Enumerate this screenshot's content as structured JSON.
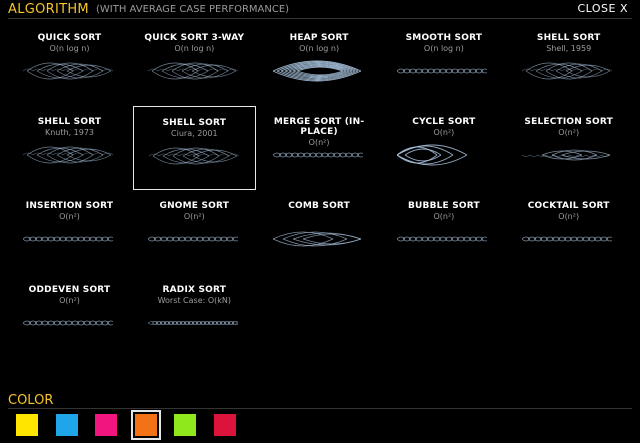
{
  "header": {
    "title": "ALGORITHM",
    "subtitle": "(WITH AVERAGE CASE PERFORMANCE)",
    "close_label": "CLOSE X"
  },
  "algorithms": [
    {
      "name": "QUICK SORT",
      "perf": "O(n log n)",
      "icon": "spread-arcs-icon"
    },
    {
      "name": "QUICK SORT 3-WAY",
      "perf": "O(n log n)",
      "icon": "spread-arcs-icon"
    },
    {
      "name": "HEAP SORT",
      "perf": "O(n log n)",
      "icon": "heap-arcs-icon"
    },
    {
      "name": "SMOOTH SORT",
      "perf": "O(n log n)",
      "icon": "chain-arcs-icon"
    },
    {
      "name": "SHELL SORT",
      "perf": "Shell, 1959",
      "icon": "spread-arcs-icon"
    },
    {
      "name": "SHELL SORT",
      "perf": "Knuth, 1973",
      "icon": "spread-arcs-icon"
    },
    {
      "name": "SHELL SORT",
      "perf": "Ciura, 2001",
      "icon": "spread-arcs-icon"
    },
    {
      "name": "MERGE SORT (IN-PLACE)",
      "perf": "O(n²)",
      "icon": "chain-arcs-icon"
    },
    {
      "name": "CYCLE SORT",
      "perf": "O(n²)",
      "icon": "cycle-arcs-icon"
    },
    {
      "name": "SELECTION SORT",
      "perf": "O(n²)",
      "icon": "selection-arcs-icon"
    },
    {
      "name": "INSERTION SORT",
      "perf": "O(n²)",
      "icon": "chain-arcs-icon"
    },
    {
      "name": "GNOME SORT",
      "perf": "O(n²)",
      "icon": "chain-arcs-icon"
    },
    {
      "name": "COMB SORT",
      "perf": "",
      "icon": "comb-arcs-icon"
    },
    {
      "name": "BUBBLE SORT",
      "perf": "O(n²)",
      "icon": "chain-arcs-icon"
    },
    {
      "name": "COCKTAIL SORT",
      "perf": "O(n²)",
      "icon": "chain-arcs-icon"
    },
    {
      "name": "ODDEVEN SORT",
      "perf": "O(n²)",
      "icon": "chain-arcs-icon"
    },
    {
      "name": "RADIX SORT",
      "perf": "Worst Case: O(kN)",
      "icon": "radix-arcs-icon"
    }
  ],
  "selected_algorithm": 6,
  "color_section": {
    "title": "COLOR",
    "swatches": [
      "#ffe500",
      "#1ea6e8",
      "#f0157f",
      "#f47216",
      "#8ee81b",
      "#dc143c"
    ],
    "selected": 3
  }
}
